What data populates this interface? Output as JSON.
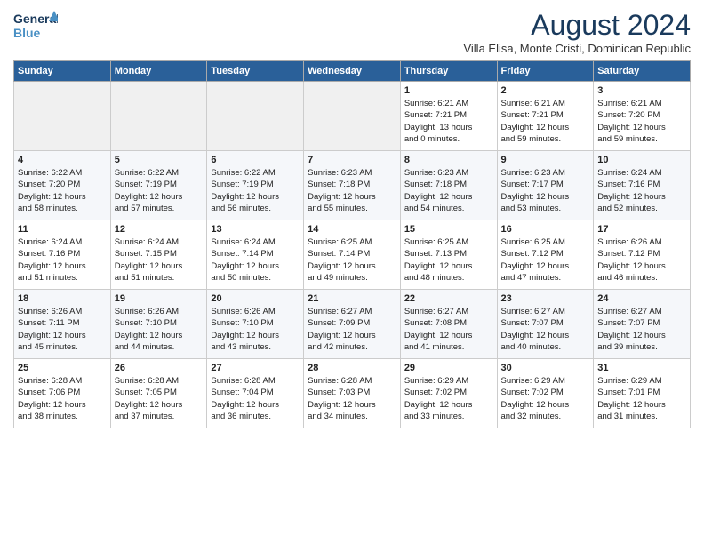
{
  "logo": {
    "line1": "General",
    "line2": "Blue"
  },
  "title": "August 2024",
  "subtitle": "Villa Elisa, Monte Cristi, Dominican Republic",
  "days_header": [
    "Sunday",
    "Monday",
    "Tuesday",
    "Wednesday",
    "Thursday",
    "Friday",
    "Saturday"
  ],
  "weeks": [
    [
      {
        "day": "",
        "info": ""
      },
      {
        "day": "",
        "info": ""
      },
      {
        "day": "",
        "info": ""
      },
      {
        "day": "",
        "info": ""
      },
      {
        "day": "1",
        "info": "Sunrise: 6:21 AM\nSunset: 7:21 PM\nDaylight: 13 hours\nand 0 minutes."
      },
      {
        "day": "2",
        "info": "Sunrise: 6:21 AM\nSunset: 7:21 PM\nDaylight: 12 hours\nand 59 minutes."
      },
      {
        "day": "3",
        "info": "Sunrise: 6:21 AM\nSunset: 7:20 PM\nDaylight: 12 hours\nand 59 minutes."
      }
    ],
    [
      {
        "day": "4",
        "info": "Sunrise: 6:22 AM\nSunset: 7:20 PM\nDaylight: 12 hours\nand 58 minutes."
      },
      {
        "day": "5",
        "info": "Sunrise: 6:22 AM\nSunset: 7:19 PM\nDaylight: 12 hours\nand 57 minutes."
      },
      {
        "day": "6",
        "info": "Sunrise: 6:22 AM\nSunset: 7:19 PM\nDaylight: 12 hours\nand 56 minutes."
      },
      {
        "day": "7",
        "info": "Sunrise: 6:23 AM\nSunset: 7:18 PM\nDaylight: 12 hours\nand 55 minutes."
      },
      {
        "day": "8",
        "info": "Sunrise: 6:23 AM\nSunset: 7:18 PM\nDaylight: 12 hours\nand 54 minutes."
      },
      {
        "day": "9",
        "info": "Sunrise: 6:23 AM\nSunset: 7:17 PM\nDaylight: 12 hours\nand 53 minutes."
      },
      {
        "day": "10",
        "info": "Sunrise: 6:24 AM\nSunset: 7:16 PM\nDaylight: 12 hours\nand 52 minutes."
      }
    ],
    [
      {
        "day": "11",
        "info": "Sunrise: 6:24 AM\nSunset: 7:16 PM\nDaylight: 12 hours\nand 51 minutes."
      },
      {
        "day": "12",
        "info": "Sunrise: 6:24 AM\nSunset: 7:15 PM\nDaylight: 12 hours\nand 51 minutes."
      },
      {
        "day": "13",
        "info": "Sunrise: 6:24 AM\nSunset: 7:14 PM\nDaylight: 12 hours\nand 50 minutes."
      },
      {
        "day": "14",
        "info": "Sunrise: 6:25 AM\nSunset: 7:14 PM\nDaylight: 12 hours\nand 49 minutes."
      },
      {
        "day": "15",
        "info": "Sunrise: 6:25 AM\nSunset: 7:13 PM\nDaylight: 12 hours\nand 48 minutes."
      },
      {
        "day": "16",
        "info": "Sunrise: 6:25 AM\nSunset: 7:12 PM\nDaylight: 12 hours\nand 47 minutes."
      },
      {
        "day": "17",
        "info": "Sunrise: 6:26 AM\nSunset: 7:12 PM\nDaylight: 12 hours\nand 46 minutes."
      }
    ],
    [
      {
        "day": "18",
        "info": "Sunrise: 6:26 AM\nSunset: 7:11 PM\nDaylight: 12 hours\nand 45 minutes."
      },
      {
        "day": "19",
        "info": "Sunrise: 6:26 AM\nSunset: 7:10 PM\nDaylight: 12 hours\nand 44 minutes."
      },
      {
        "day": "20",
        "info": "Sunrise: 6:26 AM\nSunset: 7:10 PM\nDaylight: 12 hours\nand 43 minutes."
      },
      {
        "day": "21",
        "info": "Sunrise: 6:27 AM\nSunset: 7:09 PM\nDaylight: 12 hours\nand 42 minutes."
      },
      {
        "day": "22",
        "info": "Sunrise: 6:27 AM\nSunset: 7:08 PM\nDaylight: 12 hours\nand 41 minutes."
      },
      {
        "day": "23",
        "info": "Sunrise: 6:27 AM\nSunset: 7:07 PM\nDaylight: 12 hours\nand 40 minutes."
      },
      {
        "day": "24",
        "info": "Sunrise: 6:27 AM\nSunset: 7:07 PM\nDaylight: 12 hours\nand 39 minutes."
      }
    ],
    [
      {
        "day": "25",
        "info": "Sunrise: 6:28 AM\nSunset: 7:06 PM\nDaylight: 12 hours\nand 38 minutes."
      },
      {
        "day": "26",
        "info": "Sunrise: 6:28 AM\nSunset: 7:05 PM\nDaylight: 12 hours\nand 37 minutes."
      },
      {
        "day": "27",
        "info": "Sunrise: 6:28 AM\nSunset: 7:04 PM\nDaylight: 12 hours\nand 36 minutes."
      },
      {
        "day": "28",
        "info": "Sunrise: 6:28 AM\nSunset: 7:03 PM\nDaylight: 12 hours\nand 34 minutes."
      },
      {
        "day": "29",
        "info": "Sunrise: 6:29 AM\nSunset: 7:02 PM\nDaylight: 12 hours\nand 33 minutes."
      },
      {
        "day": "30",
        "info": "Sunrise: 6:29 AM\nSunset: 7:02 PM\nDaylight: 12 hours\nand 32 minutes."
      },
      {
        "day": "31",
        "info": "Sunrise: 6:29 AM\nSunset: 7:01 PM\nDaylight: 12 hours\nand 31 minutes."
      }
    ]
  ]
}
